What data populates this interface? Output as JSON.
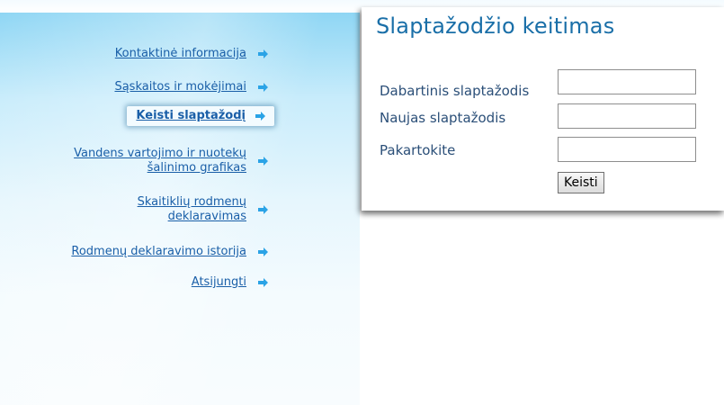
{
  "sidebar": {
    "items": [
      {
        "label": "Kontaktinė informacija"
      },
      {
        "label": "Sąskaitos ir mokėjimai"
      },
      {
        "label": "Keisti slaptažodį",
        "active": true
      },
      {
        "label_line1": "Vandens vartojimo ir nuotekų",
        "label_line2": "šalinimo grafikas"
      },
      {
        "label_line1": "Skaitiklių rodmenų",
        "label_line2": "deklaravimas"
      },
      {
        "label": "Rodmenų deklaravimo istorija"
      },
      {
        "label": "Atsijungti"
      }
    ],
    "arrow_icon": "arrow-right-icon",
    "link_color": "#1a5fa8",
    "arrow_color": "#2aa3e6"
  },
  "panel": {
    "title": "Slaptažodžio keitimas",
    "fields": [
      {
        "label": "Dabartinis slaptažodis",
        "value": ""
      },
      {
        "label": "Naujas slaptažodis",
        "value": ""
      },
      {
        "label": "Pakartokite",
        "value": ""
      }
    ],
    "submit_label": "Keisti",
    "title_color": "#1a6fa8"
  }
}
